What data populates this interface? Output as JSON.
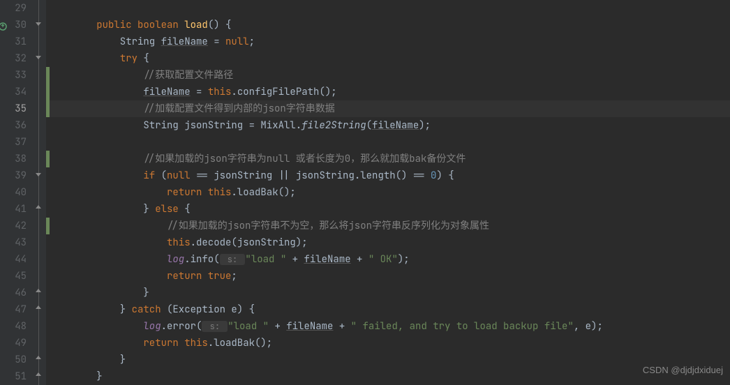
{
  "watermark": "CSDN @djdjdxiduej",
  "lines": {
    "29": "",
    "30": "    public boolean load() {",
    "31": "        String fileName = null;",
    "32": "        try {",
    "33": "            //获取配置文件路径",
    "34": "            fileName = this.configFilePath();",
    "35": "            //加载配置文件得到内部的json字符串数据",
    "36": "            String jsonString = MixAll.file2String(fileName);",
    "37": "",
    "38": "            //如果加载的json字符串为null 或者长度为0，那么就加载bak备份文件",
    "39": "            if (null == jsonString || jsonString.length() == 0) {",
    "40": "                return this.loadBak();",
    "41": "            } else {",
    "42": "                //如果加载的json字符串不为空，那么将json字符串反序列化为对象属性",
    "43": "                this.decode(jsonString);",
    "44": "                log.info( s: \"load \" + fileName + \" OK\");",
    "45": "                return true;",
    "46": "            }",
    "47": "        } catch (Exception e) {",
    "48": "            log.error( s: \"load \" + fileName + \" failed, and try to load backup file\", e);",
    "49": "            return this.loadBak();",
    "50": "        }",
    "51": "    }"
  },
  "line_numbers": [
    "29",
    "30",
    "31",
    "32",
    "33",
    "34",
    "35",
    "36",
    "37",
    "38",
    "39",
    "40",
    "41",
    "42",
    "43",
    "44",
    "45",
    "46",
    "47",
    "48",
    "49",
    "50",
    "51"
  ],
  "highlighted_line": "35",
  "changed_lines": [
    "33",
    "34",
    "35",
    "38",
    "42"
  ],
  "fold_open_lines": [
    "30",
    "32",
    "39"
  ],
  "fold_close_lines": [
    "41",
    "46",
    "47",
    "50",
    "51"
  ],
  "gutter_icon_line": "30"
}
